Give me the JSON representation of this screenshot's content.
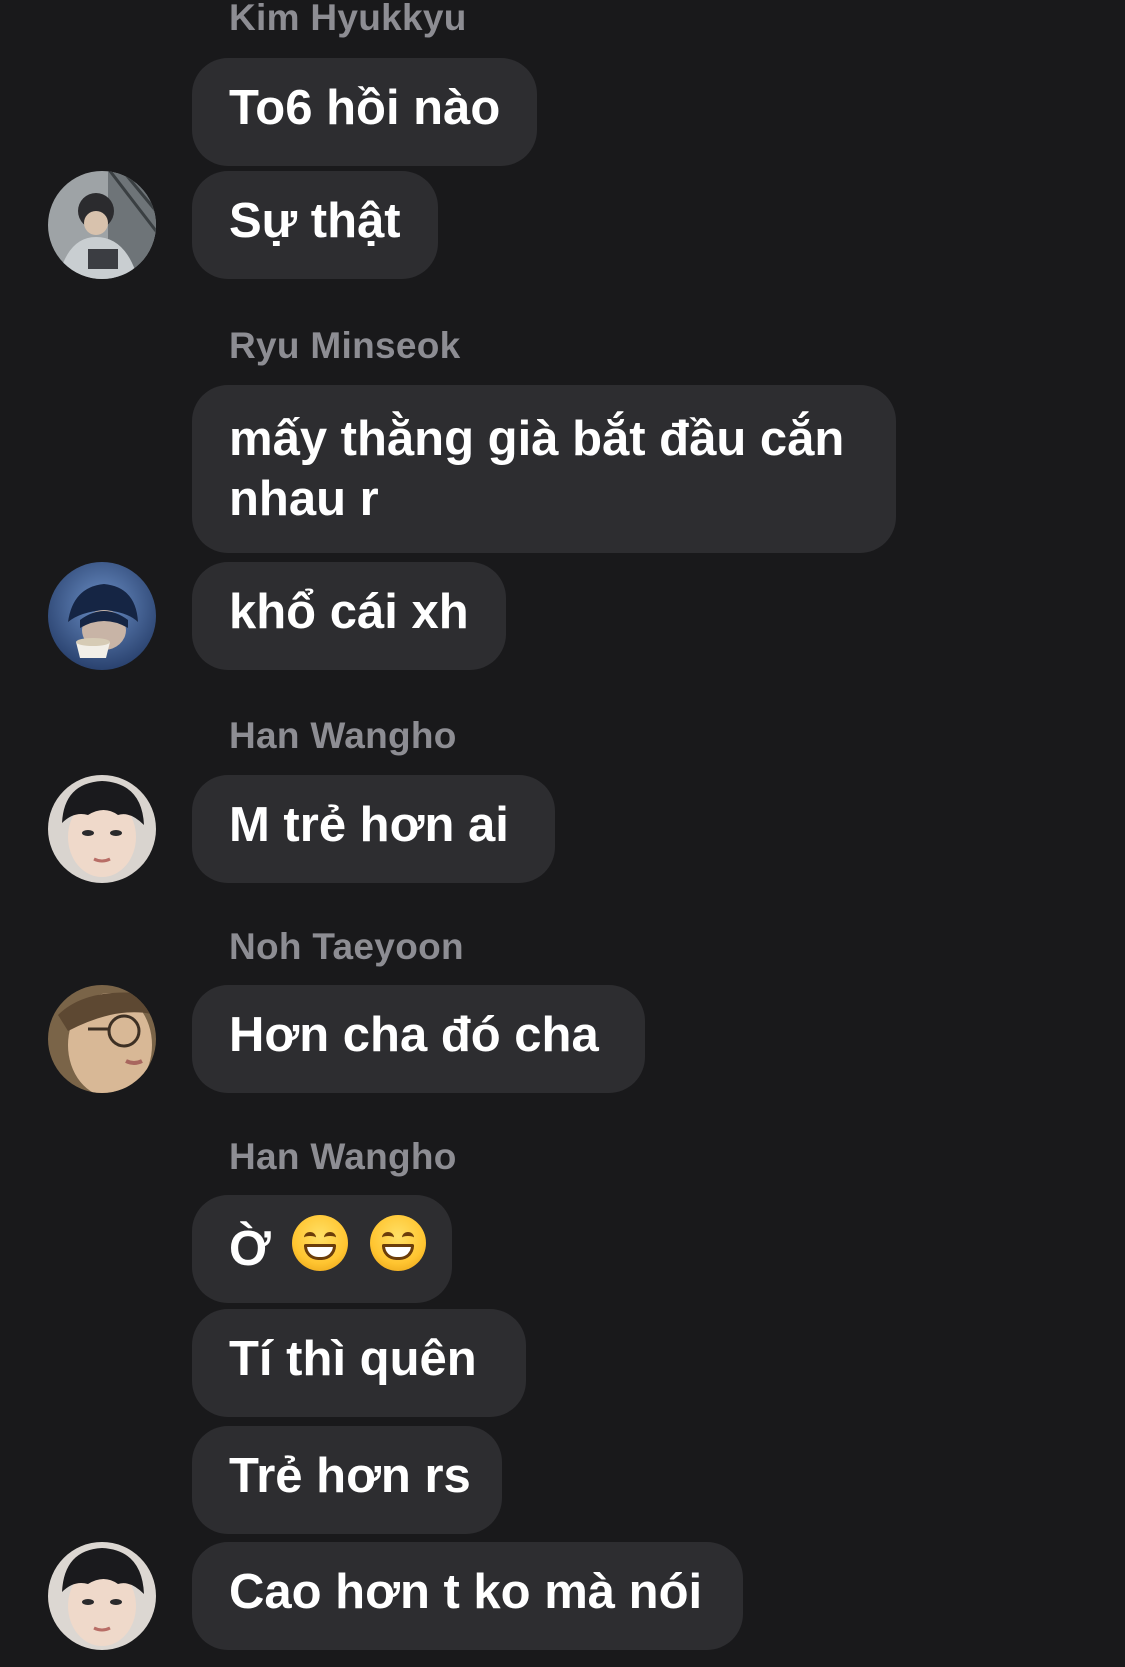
{
  "messages": [
    {
      "sender": "Kim Hyukkyu",
      "bubbles": [
        "To6 hồi nào",
        "Sự thật"
      ],
      "avatar_icon": "user-photo-icon"
    },
    {
      "sender": "Ryu Minseok",
      "bubbles": [
        "mấy thằng già bắt đầu cắn nhau r",
        "khổ cái xh"
      ],
      "avatar_icon": "user-photo-icon"
    },
    {
      "sender": "Han Wangho",
      "bubbles": [
        "M trẻ hơn ai"
      ],
      "avatar_icon": "user-photo-icon"
    },
    {
      "sender": "Noh Taeyoon",
      "bubbles": [
        "Hơn cha đó cha"
      ],
      "avatar_icon": "user-photo-icon"
    },
    {
      "sender": "Han Wangho",
      "bubbles": [
        "Ờ",
        "Tí thì quên",
        "Trẻ hơn rs",
        "Cao hơn t ko mà nói"
      ],
      "avatar_icon": "user-photo-icon"
    }
  ],
  "emoji": {
    "grinning_face": "grinning-face-icon",
    "count": 2
  },
  "colors": {
    "background": "#19191b",
    "bubble": "#2d2d30",
    "sender_name": "#8d8d93",
    "text": "#ffffff"
  }
}
